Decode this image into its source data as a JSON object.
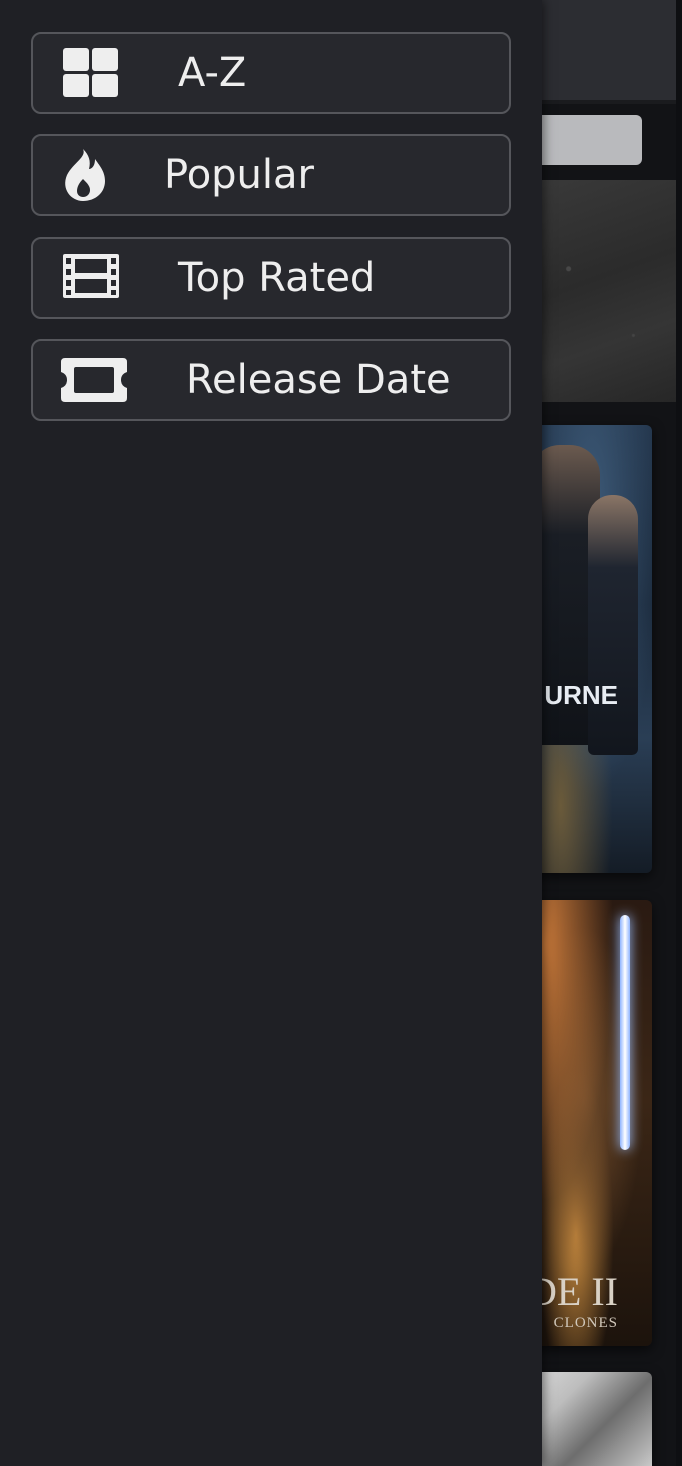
{
  "menu": {
    "items": [
      {
        "label": "A-Z",
        "icon": "grid-icon"
      },
      {
        "label": "Popular",
        "icon": "flame-icon"
      },
      {
        "label": "Top Rated",
        "icon": "film-strip-icon"
      },
      {
        "label": "Release Date",
        "icon": "ticket-icon"
      }
    ]
  },
  "background": {
    "posters": [
      {
        "title_fragment": "URNE"
      },
      {
        "title_fragment": "DE II",
        "subtitle_fragment": "CLONES"
      }
    ]
  },
  "colors": {
    "drawer_bg": "#1f2025",
    "item_bg": "#27282d",
    "item_border": "#55565b",
    "text": "#eeeeee"
  }
}
